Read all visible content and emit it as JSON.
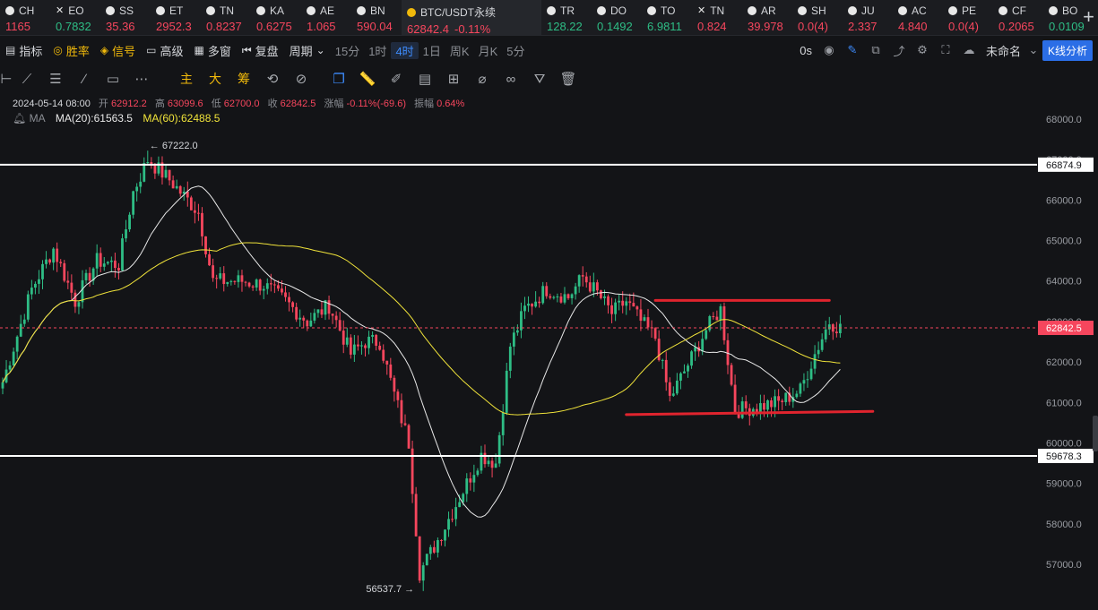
{
  "ticker_bar": {
    "items": [
      {
        "sym": "CH",
        "price": "1165",
        "dir": "dn",
        "icon": "coin-icon"
      },
      {
        "sym": "EO",
        "price": "0.7832",
        "dir": "up",
        "icon": "close-icon"
      },
      {
        "sym": "SS",
        "price": "35.36",
        "dir": "dn",
        "icon": "coin-icon"
      },
      {
        "sym": "ET",
        "price": "2952.3",
        "dir": "dn",
        "icon": "coin-icon"
      },
      {
        "sym": "TN",
        "price": "0.8237",
        "dir": "dn",
        "icon": "coin-icon"
      },
      {
        "sym": "KA",
        "price": "0.6275",
        "dir": "dn",
        "icon": "coin-icon"
      },
      {
        "sym": "AE",
        "price": "1.065",
        "dir": "dn",
        "icon": "coin-icon"
      },
      {
        "sym": "BN",
        "price": "590.04",
        "dir": "dn",
        "icon": "coin-icon"
      },
      {
        "sym": "BTC/USDT永续",
        "price": "62842.4",
        "change": "-0.11%",
        "dir": "dn",
        "icon": "binance-icon",
        "active": true
      },
      {
        "sym": "TR",
        "price": "128.22",
        "dir": "up",
        "icon": "coin-icon"
      },
      {
        "sym": "DO",
        "price": "0.1492",
        "dir": "up",
        "icon": "coin-icon"
      },
      {
        "sym": "TO",
        "price": "6.9811",
        "dir": "up",
        "icon": "coin-icon"
      },
      {
        "sym": "TN",
        "price": "0.824",
        "dir": "dn",
        "icon": "close-icon"
      },
      {
        "sym": "AR",
        "price": "39.978",
        "dir": "dn",
        "icon": "coin-icon"
      },
      {
        "sym": "SH",
        "price": "0.0(4)",
        "dir": "dn",
        "icon": "coin-icon"
      },
      {
        "sym": "JU",
        "price": "2.337",
        "dir": "dn",
        "icon": "coin-icon"
      },
      {
        "sym": "AC",
        "price": "4.840",
        "dir": "dn",
        "icon": "coin-icon"
      },
      {
        "sym": "PE",
        "price": "0.0(4)",
        "dir": "dn",
        "icon": "coin-icon"
      },
      {
        "sym": "CF",
        "price": "0.2065",
        "dir": "dn",
        "icon": "coin-icon"
      },
      {
        "sym": "BO",
        "price": "0.0109",
        "dir": "up",
        "icon": "coin-icon"
      }
    ],
    "add_label": "+"
  },
  "toolbar": {
    "indicators": "指标",
    "winrate": "胜率",
    "signal": "信号",
    "advanced": "高级",
    "multi_window": "多窗",
    "replay": "复盘",
    "period": "周期",
    "timeframes": [
      "15分",
      "1时",
      "4时",
      "1日",
      "周K",
      "月K",
      "5分"
    ],
    "selected_timeframe": "4时",
    "countdown": "0s",
    "layout_name": "未命名",
    "kline_button": "K线分析"
  },
  "drawing_tools": {
    "labels": [
      "主",
      "大",
      "筹"
    ]
  },
  "ohlc_info": {
    "date": "2024-05-14 08:00",
    "open_label": "开",
    "open": "62912.2",
    "high_label": "高",
    "high": "63099.6",
    "low_label": "低",
    "low": "62700.0",
    "close_label": "收",
    "close": "62842.5",
    "chg_label": "涨幅",
    "chg": "-0.11%(-69.6)",
    "amp_label": "振幅",
    "amp": "0.64%"
  },
  "ma_info": {
    "label": "MA",
    "ma20": "MA(20):61563.5",
    "ma60": "MA(60):62488.5"
  },
  "colors": {
    "up": "#2ebd85",
    "down": "#f6465d",
    "ma20": "#e8e8e8",
    "ma60": "#f0e33a",
    "annotation": "#e0242e"
  },
  "chart_data": {
    "type": "candlestick",
    "symbol": "BTC/USDT永续",
    "timeframe": "4时",
    "ylim": [
      56300,
      68500
    ],
    "y_ticks": [
      57000,
      58000,
      59000,
      60000,
      61000,
      62000,
      63000,
      64000,
      65000,
      66000,
      67000,
      68000
    ],
    "y_tick_labels": [
      "57000.0",
      "58000.0",
      "59000.0",
      "60000.0",
      "61000.0",
      "62000.0",
      "63000.0",
      "64000.0",
      "65000.0",
      "66000.0",
      "67000.0",
      "68000.0"
    ],
    "last_price": 62842.5,
    "last_price_label": "62842.5",
    "high_marker": {
      "value": 67222.0,
      "label": "67222.0",
      "index": 40
    },
    "low_marker": {
      "value": 56537.7,
      "label": "56537.7",
      "index": 115
    },
    "horizontal_lines": [
      {
        "value": 66874.9,
        "label": "66874.9",
        "color": "#ffffff"
      },
      {
        "value": 59678.3,
        "label": "59678.3",
        "color": "#ffffff"
      }
    ],
    "hand_drawn_lines": [
      {
        "from": [
          180,
          63520
        ],
        "to": [
          228,
          63520
        ],
        "color": "#e0242e"
      },
      {
        "from": [
          172,
          60700
        ],
        "to": [
          240,
          60780
        ],
        "color": "#e0242e"
      }
    ],
    "candle_count": 232,
    "anchors": [
      [
        0,
        61500
      ],
      [
        8,
        63800
      ],
      [
        14,
        64800
      ],
      [
        20,
        63500
      ],
      [
        26,
        64500
      ],
      [
        32,
        64400
      ],
      [
        36,
        66200
      ],
      [
        40,
        67000
      ],
      [
        46,
        66500
      ],
      [
        54,
        65700
      ],
      [
        58,
        64000
      ],
      [
        66,
        64000
      ],
      [
        72,
        63900
      ],
      [
        78,
        63500
      ],
      [
        84,
        63000
      ],
      [
        90,
        63400
      ],
      [
        96,
        62200
      ],
      [
        100,
        62500
      ],
      [
        104,
        62500
      ],
      [
        108,
        61200
      ],
      [
        112,
        60000
      ],
      [
        115,
        56800
      ],
      [
        120,
        57600
      ],
      [
        124,
        58300
      ],
      [
        128,
        59000
      ],
      [
        132,
        59700
      ],
      [
        136,
        59500
      ],
      [
        140,
        62400
      ],
      [
        144,
        63300
      ],
      [
        150,
        63800
      ],
      [
        156,
        63600
      ],
      [
        160,
        64100
      ],
      [
        164,
        63700
      ],
      [
        168,
        63200
      ],
      [
        172,
        63500
      ],
      [
        176,
        63000
      ],
      [
        180,
        62600
      ],
      [
        184,
        61100
      ],
      [
        190,
        62100
      ],
      [
        194,
        62800
      ],
      [
        198,
        63300
      ],
      [
        202,
        60800
      ],
      [
        208,
        60900
      ],
      [
        214,
        61000
      ],
      [
        220,
        61300
      ],
      [
        224,
        62200
      ],
      [
        228,
        63000
      ],
      [
        231,
        62842
      ]
    ]
  }
}
